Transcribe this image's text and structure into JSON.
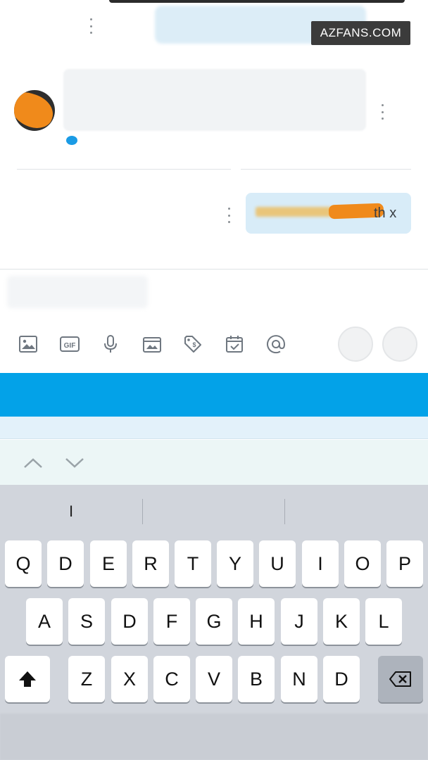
{
  "watermark": {
    "text": "AZFANS.COM"
  },
  "chat": {
    "sent_message": {
      "visible_text": "th x"
    }
  },
  "toolbar": {
    "icons": [
      "image-icon",
      "gif-icon",
      "microphone-icon",
      "media-card-icon",
      "price-tag-icon",
      "calendar-check-icon",
      "mention-icon"
    ],
    "gif_label": "GIF"
  },
  "keyboard": {
    "suggestions": [
      "I",
      "",
      ""
    ],
    "row1": [
      "Q",
      "D",
      "E",
      "R",
      "T",
      "Y",
      "U",
      "I",
      "O",
      "P"
    ],
    "row2": [
      "A",
      "S",
      "D",
      "F",
      "G",
      "H",
      "J",
      "K",
      "L"
    ],
    "row3": [
      "Z",
      "X",
      "C",
      "V",
      "B",
      "N",
      "D"
    ]
  },
  "colors": {
    "accent_blue": "#03a2e8",
    "keyboard_bg": "#d1d5dc",
    "bubble_bg": "#d8ecf8"
  }
}
